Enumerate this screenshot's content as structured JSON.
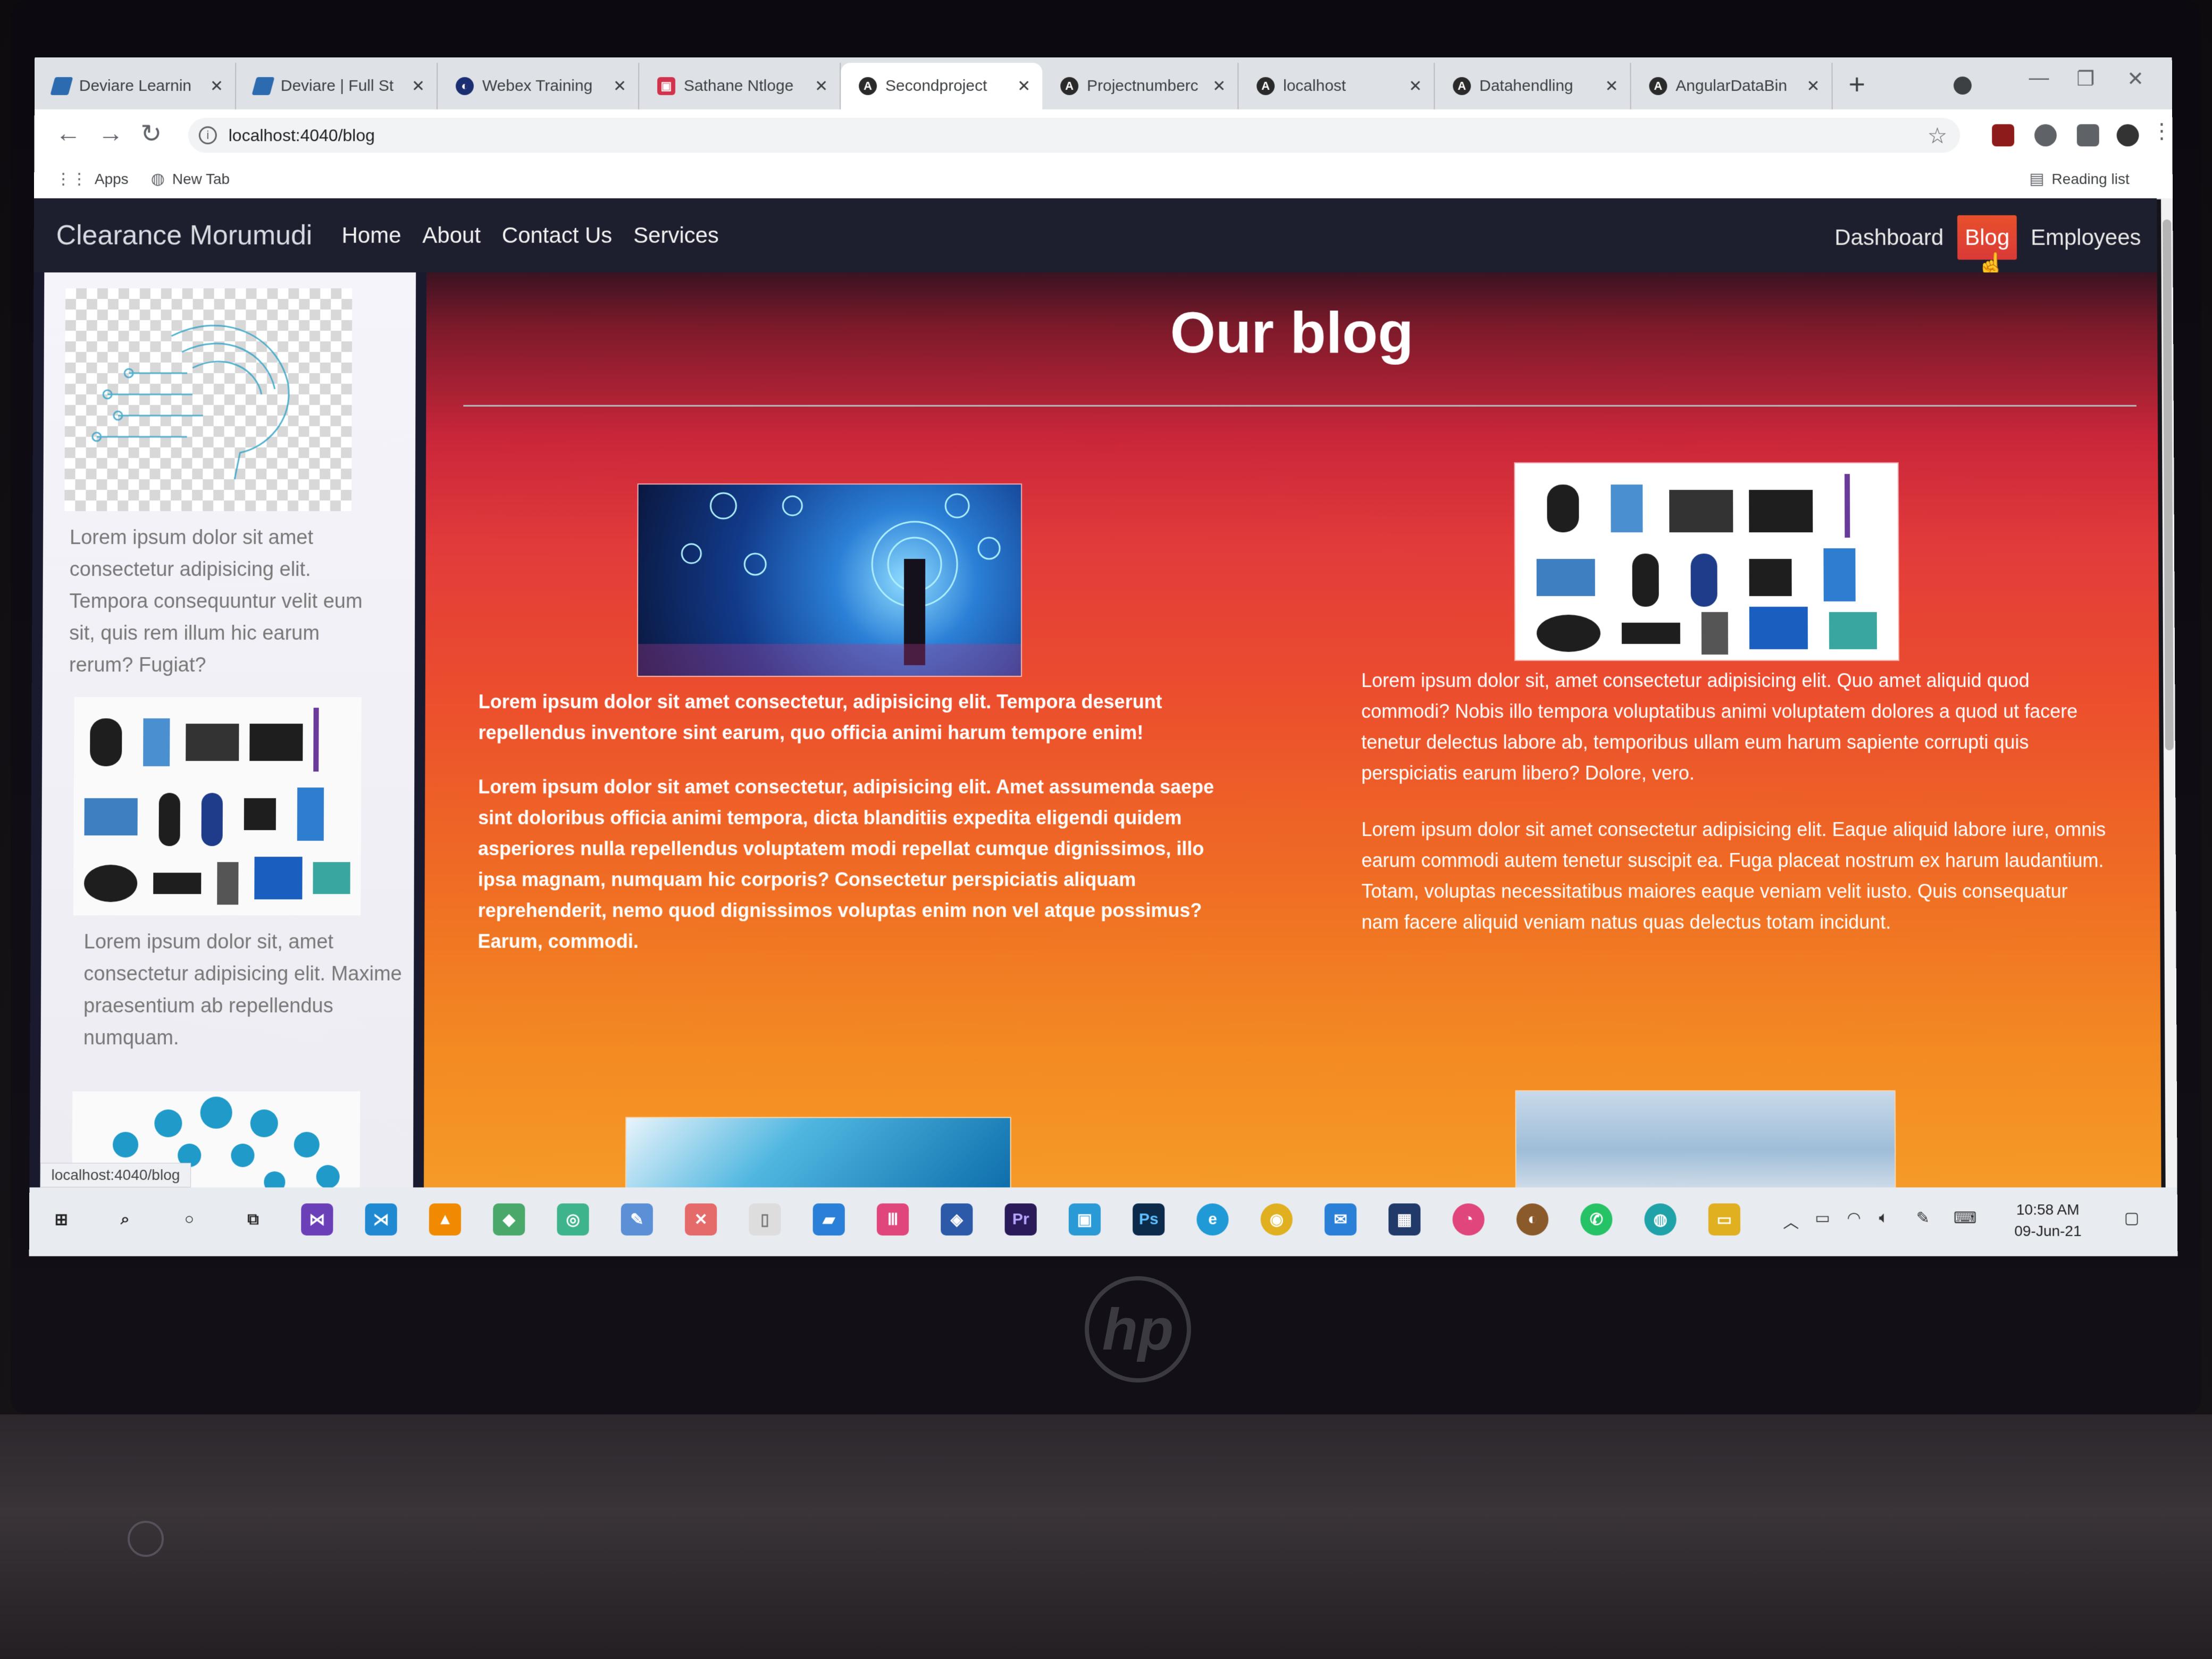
{
  "browser": {
    "tabs": [
      {
        "label": "Deviare Learnin",
        "icon": "deviare-icon"
      },
      {
        "label": "Deviare | Full St",
        "icon": "deviare-icon"
      },
      {
        "label": "Webex Training",
        "icon": "webex-icon"
      },
      {
        "label": "Sathane Ntloge",
        "icon": "sathane-icon"
      },
      {
        "label": "Secondproject",
        "icon": "angular-icon"
      },
      {
        "label": "Projectnumberc",
        "icon": "angular-icon"
      },
      {
        "label": "localhost",
        "icon": "angular-icon"
      },
      {
        "label": "Datahendling",
        "icon": "angular-icon"
      },
      {
        "label": "AngularDataBin",
        "icon": "angular-icon"
      }
    ],
    "active_tab": 4,
    "url": "localhost:4040/blog",
    "bookmarks": {
      "apps": "Apps",
      "new_tab": "New Tab",
      "reading_list": "Reading list"
    }
  },
  "nav": {
    "brand": "Clearance Morumudi",
    "left": [
      "Home",
      "About",
      "Contact Us",
      "Services"
    ],
    "right": [
      "Dashboard",
      "Blog",
      "Employees"
    ],
    "active": "Blog"
  },
  "sidebar": {
    "text1": "Lorem ipsum dolor sit amet consectetur adipisicing elit. Tempora consequuntur velit eum sit, quis rem illum hic earum rerum? Fugiat?",
    "text2": "Lorem ipsum dolor sit, amet consectetur adipisicing elit. Maxime praesentium ab repellendus numquam."
  },
  "status_bar_url": "localhost:4040/blog",
  "blog": {
    "title": "Our blog",
    "posts": [
      {
        "p1": "Lorem ipsum dolor sit amet consectetur, adipisicing elit. Tempora deserunt repellendus inventore sint earum, quo officia animi harum tempore enim!",
        "p2": "Lorem ipsum dolor sit amet consectetur, adipisicing elit. Amet assumenda saepe sint doloribus officia animi tempora, dicta blanditiis expedita eligendi quidem asperiores nulla repellendus voluptatem modi repellat cumque dignissimos, illo ipsa magnam, numquam hic corporis? Consectetur perspiciatis aliquam reprehenderit, nemo quod dignissimos voluptas enim non vel atque possimus? Earum, commodi."
      },
      {
        "p1": "Lorem ipsum dolor sit, amet consectetur adipisicing elit. Quo amet aliquid quod commodi? Nobis illo tempora voluptatibus animi voluptatem dolores a quod ut facere tenetur delectus labore ab, temporibus ullam eum harum sapiente corrupti quis perspiciatis earum libero? Dolore, vero.",
        "p2": "Lorem ipsum dolor sit amet consectetur adipisicing elit. Eaque aliquid labore iure, omnis earum commodi autem tenetur suscipit ea. Fuga placeat nostrum ex harum laudantium. Totam, voluptas necessitatibus maiores eaque veniam velit iusto. Quis consequatur nam facere aliquid veniam natus quas delectus totam incidunt."
      }
    ]
  },
  "taskbar": {
    "clock_time": "10:58 AM",
    "clock_date": "09-Jun-21"
  },
  "colors": {
    "active_nav": "#e8502c",
    "navbar_bg": "#1e1f2e",
    "gradient_top": "#c9263a",
    "gradient_bottom": "#f59a28"
  }
}
